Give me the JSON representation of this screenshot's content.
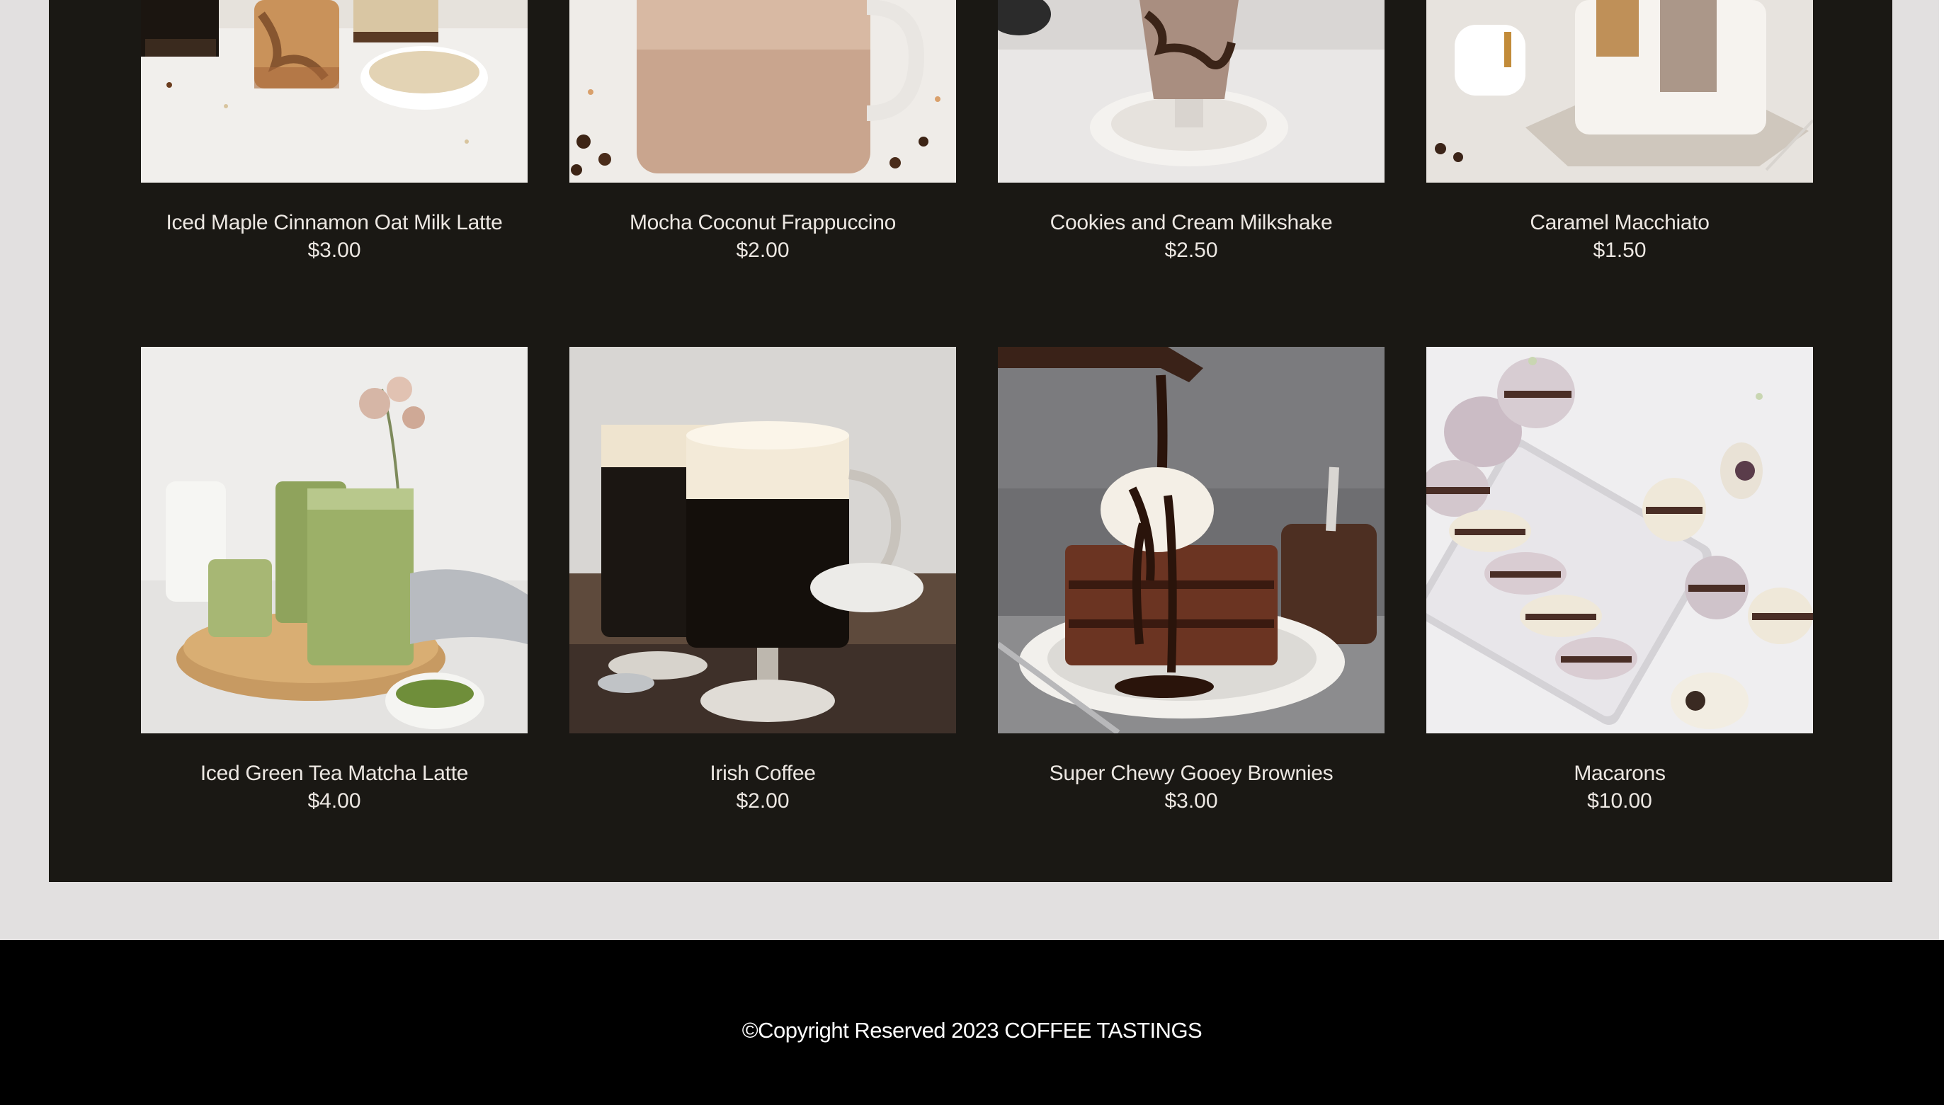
{
  "products": [
    {
      "name": "Iced Maple Cinnamon Oat Milk Latte",
      "price": "$3.00"
    },
    {
      "name": "Mocha Coconut Frappuccino",
      "price": "$2.00"
    },
    {
      "name": "Cookies and Cream Milkshake",
      "price": "$2.50"
    },
    {
      "name": "Caramel Macchiato",
      "price": "$1.50"
    },
    {
      "name": "Iced Green Tea Matcha Latte",
      "price": "$4.00"
    },
    {
      "name": "Irish Coffee",
      "price": "$2.00"
    },
    {
      "name": "Super Chewy Gooey Brownies",
      "price": "$3.00"
    },
    {
      "name": "Macarons",
      "price": "$10.00"
    }
  ],
  "footer": {
    "copyright": "©Copyright Reserved 2023 COFFEE TASTINGS"
  },
  "colors": {
    "page_background": "#e2e0e0",
    "menu_background": "#1a1814",
    "footer_background": "#000000",
    "text": "#ece7e2"
  }
}
